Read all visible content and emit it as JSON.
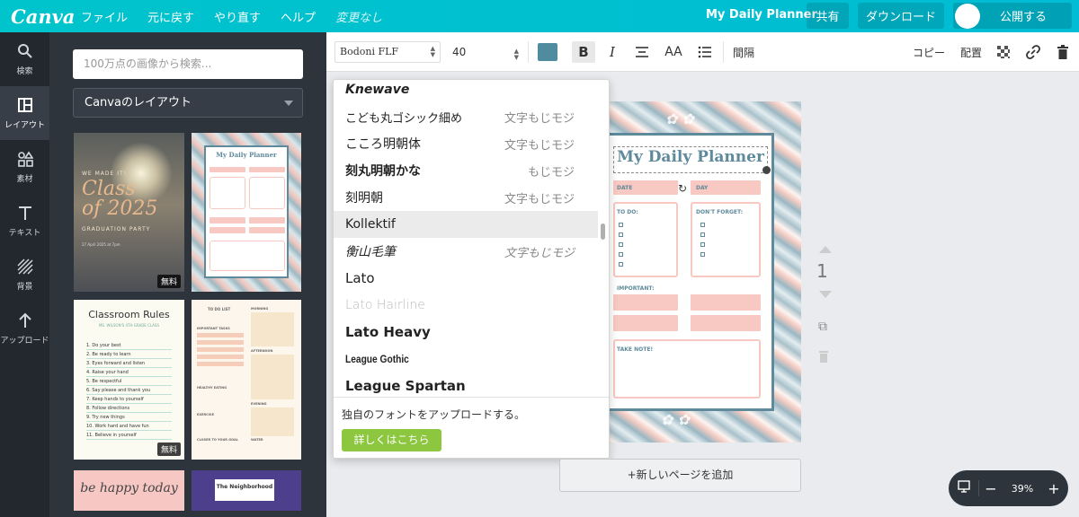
{
  "topbar": {
    "logo": "Canva",
    "menu": [
      "ファイル",
      "元に戻す",
      "やり直す",
      "ヘルプ"
    ],
    "status": "変更なし",
    "doc_title": "My Daily Planner",
    "share": "共有",
    "download": "ダウンロード",
    "publish": "公開する"
  },
  "rail": [
    {
      "label": "検索",
      "icon": "search-icon"
    },
    {
      "label": "レイアウト",
      "icon": "layout-icon"
    },
    {
      "label": "素材",
      "icon": "elements-icon"
    },
    {
      "label": "テキスト",
      "icon": "text-icon"
    },
    {
      "label": "背景",
      "icon": "background-icon"
    },
    {
      "label": "アップロード",
      "icon": "upload-icon"
    }
  ],
  "panel": {
    "search_placeholder": "100万点の画像から検索...",
    "layout_select": "Canvaのレイアウト",
    "free_badge": "無料",
    "thumb1": {
      "line1": "WE MADE IT!",
      "line2": "Class",
      "line3": "of 2025",
      "line4": "GRADUATION PARTY",
      "line5": "27 April 2025 at 7pm"
    },
    "thumb2": {
      "title": "My Daily Planner"
    },
    "thumb3": {
      "title": "Classroom Rules",
      "sub": "MS. WILSON'S 4TH GRADE CLASS",
      "rules": [
        "1. Do your best",
        "2. Be ready to learn",
        "3. Eyes forward and listen",
        "4. Raise your hand",
        "5. Be respectful",
        "6. Say please and thank you",
        "7. Keep hands to yourself",
        "8. Follow directions",
        "9. Try new things",
        "10. Work hard and have fun",
        "11. Believe in yourself"
      ]
    },
    "thumb4": {
      "title": "TO DO LIST",
      "morning": "MORNING",
      "afternoon": "AFTERNOON",
      "evening": "EVENING",
      "important": "IMPORTANT TASKS",
      "healthy": "HEALTHY EATING",
      "exercise": "EXERCISE",
      "closer": "CLOSER TO YOUR GOAL",
      "water": "WATER"
    },
    "thumb5": {
      "text": "be happy today"
    },
    "thumb6": {
      "text": "The Neighborhood"
    }
  },
  "toolbar": {
    "font": "Bodoni FLF",
    "size": "40",
    "color": "#4f8ca0",
    "bold": "B",
    "italic": "I",
    "aa": "AA",
    "spacing": "間隔",
    "copy": "コピー",
    "arrange": "配置"
  },
  "font_list": [
    {
      "name": "Knewave",
      "sample": ""
    },
    {
      "name": "こども丸ゴシック細め",
      "sample": "文字もじモジ"
    },
    {
      "name": "こころ明朝体",
      "sample": "文字もじモジ"
    },
    {
      "name": "刻丸明朝かな",
      "sample": "もじモジ"
    },
    {
      "name": "刻明朝",
      "sample": "文字もじモジ"
    },
    {
      "name": "Kollektif",
      "sample": ""
    },
    {
      "name": "衡山毛筆",
      "sample": "文字もじモジ"
    },
    {
      "name": "Lato",
      "sample": ""
    },
    {
      "name": "Lato Hairline",
      "sample": ""
    },
    {
      "name": "Lato Heavy",
      "sample": ""
    },
    {
      "name": "League Gothic",
      "sample": ""
    },
    {
      "name": "League Spartan",
      "sample": ""
    }
  ],
  "dropdown_footer": {
    "text": "独自のフォントをアップロードする。",
    "button": "詳しくはこちら"
  },
  "canvas": {
    "planner_title": "My Daily Planner",
    "date": "DATE",
    "day": "DAY",
    "todo": "TO DO:",
    "dont_forget": "DON'T FORGET:",
    "important": "IMPORTANT:",
    "take_note": "TAKE NOTE!",
    "page_number": "1",
    "add_page": "+新しいページを追加"
  },
  "zoom": {
    "value": "39%",
    "minus": "−",
    "plus": "+"
  }
}
